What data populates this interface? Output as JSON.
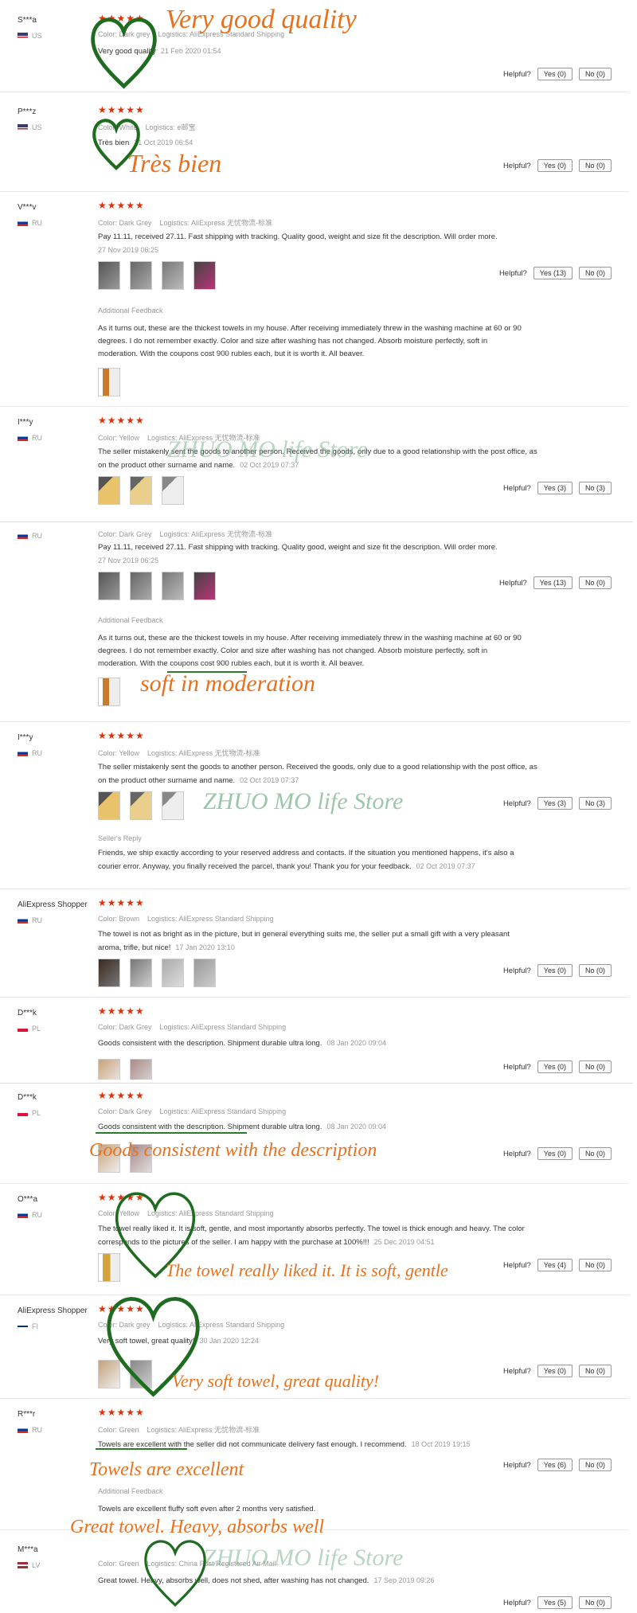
{
  "helpful_label": "Helpful?",
  "stars": "★★★★★",
  "additional_feedback": "Additional Feedback",
  "seller_reply_label": "Seller's Reply",
  "colors": {
    "star": "#e62e04",
    "annotation": "#e8711d",
    "heart": "#1f6b1f",
    "watermark": "#78b48c"
  },
  "panel1": {
    "r1": {
      "user": "S***a",
      "country": "US",
      "color": "Color: Dark grey",
      "logistics": "Logistics: AliExpress Standard Shipping",
      "text": "Very good quality",
      "date": "21 Feb 2020 01:54",
      "yes": "Yes (0)",
      "no": "No (0)"
    },
    "r2": {
      "user": "P***z",
      "country": "US",
      "color": "Color: White",
      "logistics": "Logistics: e邮宝",
      "text": "Très bien",
      "date": "31 Oct 2019 06:54",
      "yes": "Yes (0)",
      "no": "No (0)"
    },
    "r3": {
      "user": "V***v",
      "country": "RU",
      "color": "Color: Dark Grey",
      "logistics": "Logistics: AliExpress 无忧物流-标准",
      "text": "Pay 11.11, received 27.11. Fast shipping with tracking. Quality good, weight and size fit the description. Will order more.",
      "date": "27 Nov 2019 06:25",
      "yes": "Yes (13)",
      "no": "No (0)",
      "additional": "As it turns out, these are the thickest towels in my house. After receiving immediately threw in the washing machine at 60 or 90 degrees. I do not remember exactly. Color and size after washing has not changed. Absorb moisture perfectly, soft in moderation. With the coupons cost 900 rubles each, but it is worth it. All beaver."
    },
    "r4": {
      "user": "I***y",
      "country": "RU",
      "color": "Color: Yellow",
      "logistics": "Logistics: AliExpress 无忧物流-标准",
      "text": "The seller mistakenly sent the goods to another person. Received the goods, only due to a good relationship with the post office, as on the product other surname and name.",
      "date": "02 Oct 2019 07:37",
      "yes": "Yes (3)",
      "no": "No (3)"
    }
  },
  "panel2": {
    "r1": {
      "country": "RU",
      "color": "Color: Dark Grey",
      "logistics": "Logistics: AliExpress 无忧物流-标准",
      "text": "Pay 11.11, received 27.11. Fast shipping with tracking. Quality good, weight and size fit the description. Will order more.",
      "date": "27 Nov 2019 06:25",
      "yes": "Yes (13)",
      "no": "No (0)",
      "additional": "As it turns out, these are the thickest towels in my house. After receiving immediately threw in the washing machine at 60 or 90 degrees. I do not remember exactly. Color and size after washing has not changed. Absorb moisture perfectly, soft in moderation. With the coupons cost 900 rubles each, but it is worth it. All beaver."
    },
    "r2": {
      "user": "I***y",
      "country": "RU",
      "color": "Color: Yellow",
      "logistics": "Logistics: AliExpress 无忧物流-标准",
      "text": "The seller mistakenly sent the goods to another person. Received the goods, only due to a good relationship with the post office, as on the product other surname and name.",
      "date": "02 Oct 2019 07:37",
      "yes": "Yes (3)",
      "no": "No (3)",
      "reply": "Friends, we ship exactly according to your reserved address and contacts. If the situation you mentioned happens, it's also a courier error. Anyway, you finally received the parcel, thank you! Thank you for your feedback.",
      "reply_date": "02 Oct 2019 07:37"
    },
    "r3": {
      "user": "AliExpress Shopper",
      "country": "RU",
      "color": "Color: Brown",
      "logistics": "Logistics: AliExpress Standard Shipping",
      "text": "The towel is not as bright as in the picture, but in general everything suits me, the seller put a small gift with a very pleasant aroma, trifle, but nice!",
      "date": "17 Jan 2020 13:10",
      "yes": "Yes (0)",
      "no": "No (0)"
    },
    "r4": {
      "user": "D***k",
      "country": "PL",
      "color": "Color: Dark Grey",
      "logistics": "Logistics: AliExpress Standard Shipping",
      "text": "Goods consistent with the description. Shipment durable ultra long.",
      "date": "08 Jan 2020 09:04",
      "yes": "Yes (0)",
      "no": "No (0)"
    }
  },
  "panel3": {
    "r1": {
      "user": "D***k",
      "country": "PL",
      "color": "Color: Dark Grey",
      "logistics": "Logistics: AliExpress Standard Shipping",
      "text": "Goods consistent with the description. Shipment durable ultra long.",
      "date": "08 Jan 2020 09:04",
      "yes": "Yes (0)",
      "no": "No (0)"
    },
    "r2": {
      "user": "O***a",
      "country": "RU",
      "color": "Color: Yellow",
      "logistics": "Logistics: AliExpress Standard Shipping",
      "text": "The towel really liked it. It is soft, gentle, and most importantly absorbs perfectly. The towel is thick enough and heavy. The color corresponds to the pictures of the seller. I am happy with the purchase at 100%!!!",
      "date": "25 Dec 2019 04:51",
      "yes": "Yes (4)",
      "no": "No (0)"
    },
    "r3": {
      "user": "AliExpress Shopper",
      "country": "FI",
      "color": "Color: Dark grey",
      "logistics": "Logistics: AliExpress Standard Shipping",
      "text": "Very soft towel, great quality!",
      "date": "30 Jan 2020 12:24",
      "yes": "Yes (0)",
      "no": "No (0)"
    },
    "r4": {
      "user": "R***r",
      "country": "RU",
      "color": "Color: Green",
      "logistics": "Logistics: AliExpress 无忧物流-标准",
      "text": "Towels are excellent with the seller did not communicate delivery fast enough. I recommend.",
      "date": "18 Oct 2019 19:15",
      "yes": "Yes (6)",
      "no": "No (0)",
      "additional": "Towels are excellent fluffy soft even after 2 months very satisfied."
    },
    "r5": {
      "user": "M***a",
      "country": "LV",
      "color": "Color: Green",
      "logistics": "Logistics: China Post Registered Air Mail",
      "text": "Great towel. Heavy, absorbs well, does not shed, after washing has not changed.",
      "date": "17 Sep 2019 09:26",
      "yes": "Yes (5)",
      "no": "No (0)"
    }
  },
  "annotations": {
    "very_good_quality": "Very good quality",
    "tres_bien": "Très bien",
    "soft_in_moderation": "soft in moderation",
    "goods_consistent": "Goods consistent with the description",
    "towel_really_liked": "The towel really liked it. It is soft, gentle",
    "very_soft_towel": "Very soft towel, great quality!",
    "towels_excellent": "Towels are excellent",
    "great_towel": "Great towel. Heavy, absorbs well"
  },
  "watermark": "ZHUO MO life Store"
}
